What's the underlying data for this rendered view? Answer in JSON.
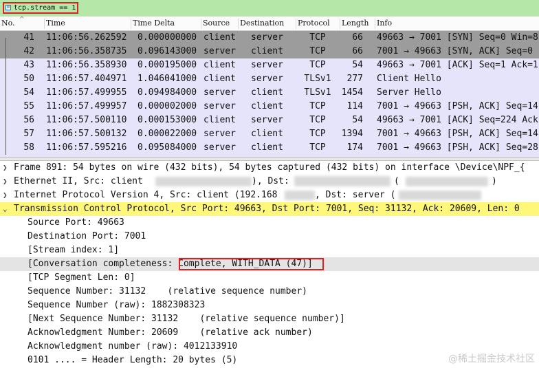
{
  "filter": {
    "value": "tcp.stream == 1"
  },
  "columns": [
    "No.",
    "Time",
    "Time Delta",
    "Source",
    "Destination",
    "Protocol",
    "Length",
    "Info"
  ],
  "packets": [
    {
      "no": "41",
      "time": "11:06:56.262592",
      "delta": "0.000000000",
      "src": "client",
      "dst": "server",
      "proto": "TCP",
      "len": "66",
      "info": "49663 → 7001 [SYN] Seq=0 Win=8"
    },
    {
      "no": "42",
      "time": "11:06:56.358735",
      "delta": "0.096143000",
      "src": "server",
      "dst": "client",
      "proto": "TCP",
      "len": "66",
      "info": "7001 → 49663 [SYN, ACK] Seq=0"
    },
    {
      "no": "43",
      "time": "11:06:56.358930",
      "delta": "0.000195000",
      "src": "client",
      "dst": "server",
      "proto": "TCP",
      "len": "54",
      "info": "49663 → 7001 [ACK] Seq=1 Ack=1"
    },
    {
      "no": "50",
      "time": "11:06:57.404971",
      "delta": "1.046041000",
      "src": "client",
      "dst": "server",
      "proto": "TLSv1",
      "len": "277",
      "info": "Client Hello"
    },
    {
      "no": "54",
      "time": "11:06:57.499955",
      "delta": "0.094984000",
      "src": "server",
      "dst": "client",
      "proto": "TLSv1",
      "len": "1454",
      "info": "Server Hello"
    },
    {
      "no": "55",
      "time": "11:06:57.499957",
      "delta": "0.000002000",
      "src": "server",
      "dst": "client",
      "proto": "TCP",
      "len": "114",
      "info": "7001 → 49663 [PSH, ACK] Seq=14"
    },
    {
      "no": "56",
      "time": "11:06:57.500110",
      "delta": "0.000153000",
      "src": "client",
      "dst": "server",
      "proto": "TCP",
      "len": "54",
      "info": "49663 → 7001 [ACK] Seq=224 Ack"
    },
    {
      "no": "57",
      "time": "11:06:57.500132",
      "delta": "0.000022000",
      "src": "server",
      "dst": "client",
      "proto": "TCP",
      "len": "1394",
      "info": "7001 → 49663 [PSH, ACK] Seq=14"
    },
    {
      "no": "58",
      "time": "11:06:57.595216",
      "delta": "0.095084000",
      "src": "server",
      "dst": "client",
      "proto": "TCP",
      "len": "174",
      "info": "7001 → 49663 [PSH, ACK] Seq=28"
    }
  ],
  "details": {
    "frame": "Frame 891: 54 bytes on wire (432 bits), 54 bytes captured (432 bits) on interface \\Device\\NPF_{",
    "ethernet": "Ethernet II, Src: client",
    "ethernet_dst": "), Dst:",
    "ethernet_end": "(",
    "ethernet_close": ")",
    "ip": "Internet Protocol Version 4, Src: client (192.168",
    "ip_dst": ", Dst: server (",
    "tcp": "Transmission Control Protocol, Src Port: 49663, Dst Port: 7001, Seq: 31132, Ack: 20609, Len: 0",
    "fields": [
      "Source Port: 49663",
      "Destination Port: 7001",
      "[Stream index: 1]",
      "[Conversation completeness: Complete, WITH_DATA (47)]",
      "[TCP Segment Len: 0]",
      "Sequence Number: 31132    (relative sequence number)",
      "Sequence Number (raw): 1882308323",
      "[Next Sequence Number: 31132    (relative sequence number)]",
      "Acknowledgment Number: 20609    (relative ack number)",
      "Acknowledgment number (raw): 4012133910",
      "0101 .... = Header Length: 20 bytes (5)"
    ]
  },
  "watermark": "@稀土掘金技术社区"
}
